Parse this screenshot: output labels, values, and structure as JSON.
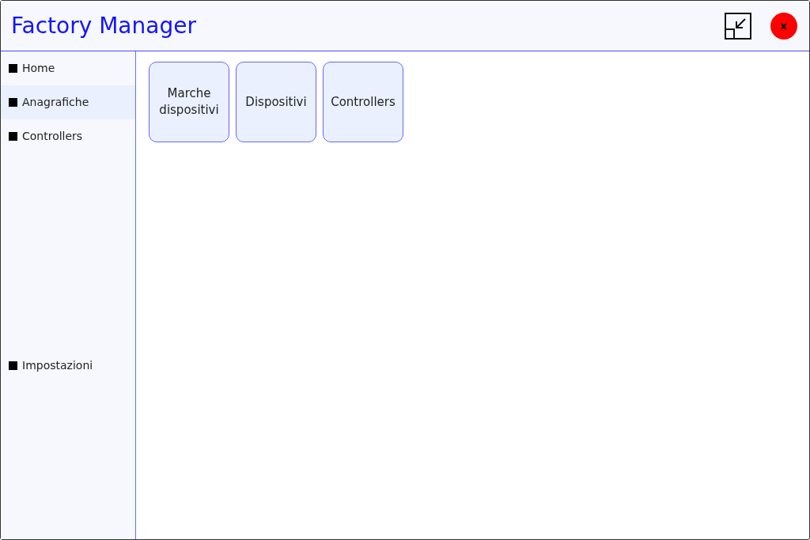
{
  "window": {
    "title": "Factory Manager",
    "close_label": "x"
  },
  "sidebar": {
    "items": [
      {
        "label": "Home",
        "selected": false
      },
      {
        "label": "Anagrafiche",
        "selected": true
      },
      {
        "label": "Controllers",
        "selected": false
      }
    ],
    "bottom_items": [
      {
        "label": "Impostazioni",
        "selected": false
      }
    ]
  },
  "tiles": [
    {
      "label": "Marche dispositivi"
    },
    {
      "label": "Dispositivi"
    },
    {
      "label": "Controllers"
    }
  ]
}
